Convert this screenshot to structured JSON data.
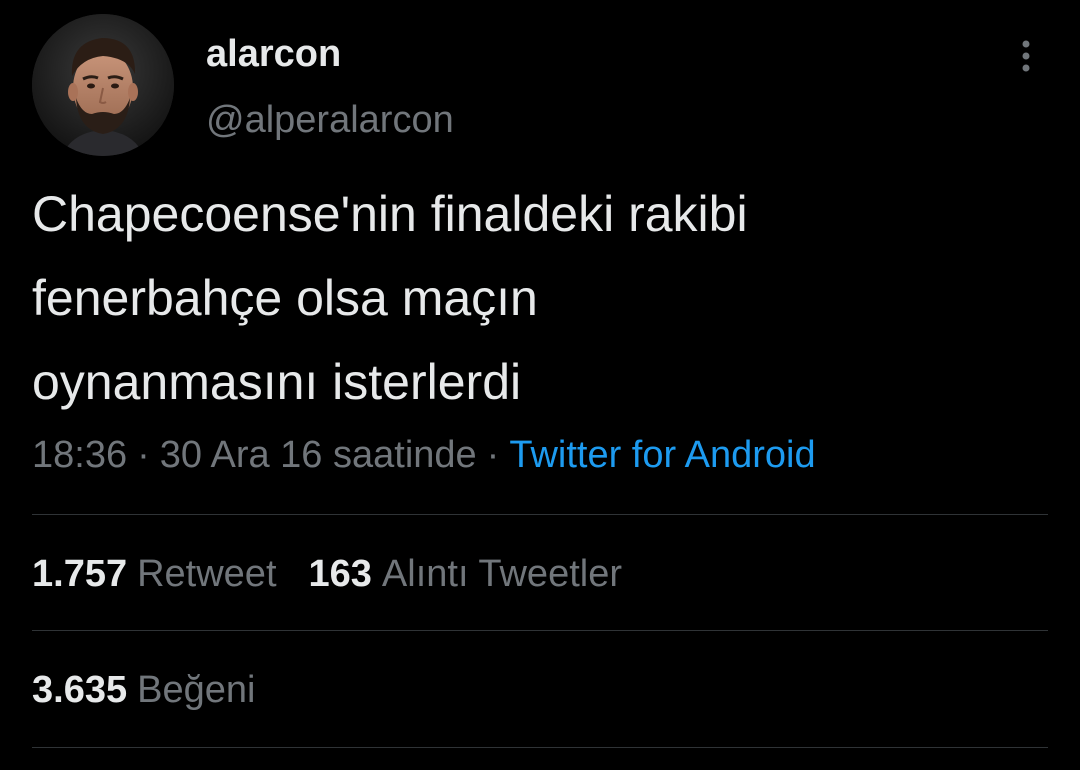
{
  "author": {
    "display_name": "alarcon",
    "handle": "@alperalarcon",
    "avatar_icon": "profile-photo"
  },
  "more_icon": "more-vertical-icon",
  "tweet": {
    "lines": [
      "Chapecoense'nin finaldeki rakibi",
      "fenerbahçe olsa maçın",
      "oynanmasını isterlerdi"
    ]
  },
  "meta": {
    "time": "18:36",
    "date": "30 Ara 16 saatinde",
    "separator": "·",
    "source": "Twitter for Android"
  },
  "stats": {
    "retweets": {
      "count": "1.757",
      "label": "Retweet"
    },
    "quotes": {
      "count": "163",
      "label": "Alıntı Tweetler"
    },
    "likes": {
      "count": "3.635",
      "label": "Beğeni"
    }
  },
  "colors": {
    "background": "#000000",
    "primary_text": "#e7e9ea",
    "secondary_text": "#71767b",
    "link": "#1d9bf0",
    "divider": "#2f3336"
  }
}
